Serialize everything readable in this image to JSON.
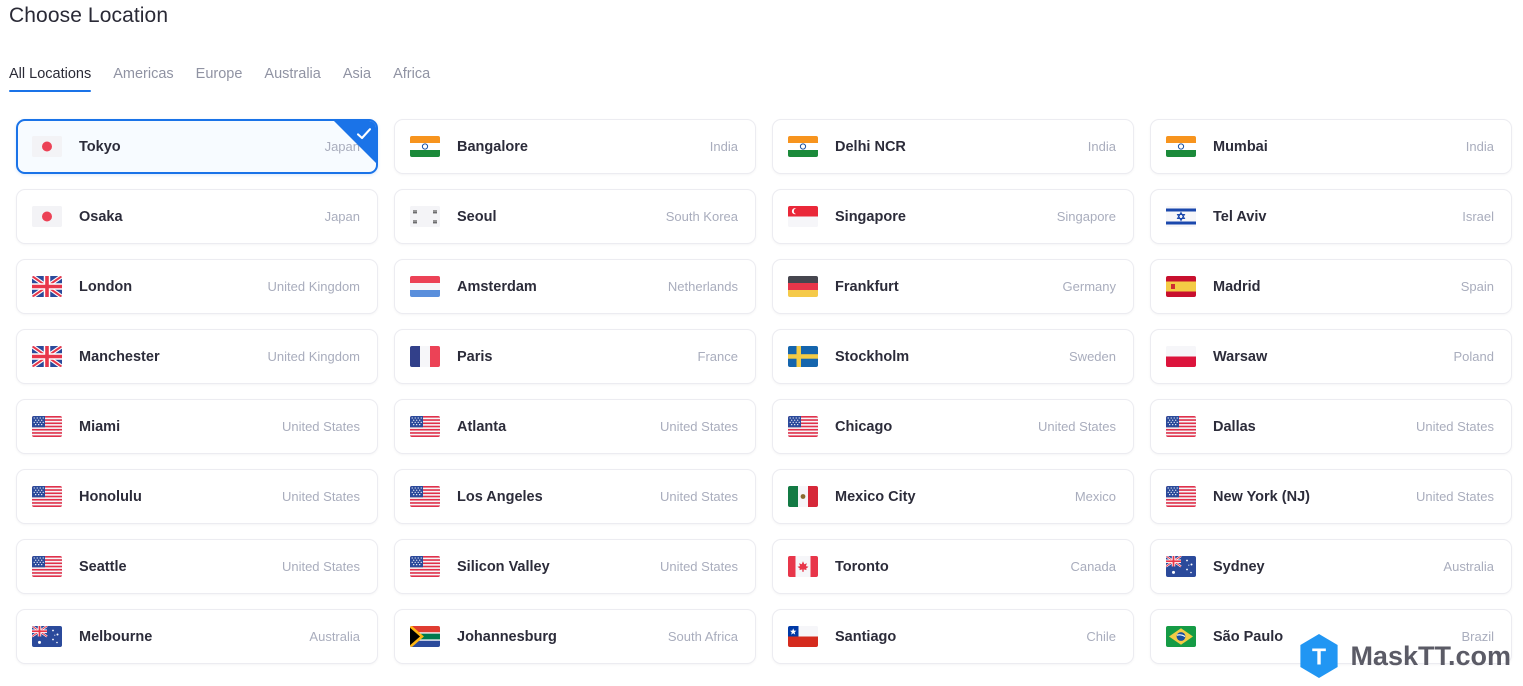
{
  "header": {
    "title": "Choose Location"
  },
  "tabs": [
    {
      "label": "All Locations",
      "active": true
    },
    {
      "label": "Americas",
      "active": false
    },
    {
      "label": "Europe",
      "active": false
    },
    {
      "label": "Australia",
      "active": false
    },
    {
      "label": "Asia",
      "active": false
    },
    {
      "label": "Africa",
      "active": false
    }
  ],
  "colors": {
    "accent": "#1a73e8",
    "card_border": "#ececf1",
    "city_text": "#2c2c3a",
    "country_text": "#a9adbd",
    "selected_bg": "#f7fbff",
    "watermark_text": "#5b5b66"
  },
  "selection": {
    "selected_city": "Tokyo",
    "check_icon": "check-icon"
  },
  "locations": [
    {
      "city": "Tokyo",
      "country": "Japan",
      "flag": "jp",
      "selected": true
    },
    {
      "city": "Bangalore",
      "country": "India",
      "flag": "in",
      "selected": false
    },
    {
      "city": "Delhi NCR",
      "country": "India",
      "flag": "in",
      "selected": false
    },
    {
      "city": "Mumbai",
      "country": "India",
      "flag": "in",
      "selected": false
    },
    {
      "city": "Osaka",
      "country": "Japan",
      "flag": "jp",
      "selected": false
    },
    {
      "city": "Seoul",
      "country": "South Korea",
      "flag": "kr",
      "selected": false
    },
    {
      "city": "Singapore",
      "country": "Singapore",
      "flag": "sg",
      "selected": false
    },
    {
      "city": "Tel Aviv",
      "country": "Israel",
      "flag": "il",
      "selected": false
    },
    {
      "city": "London",
      "country": "United Kingdom",
      "flag": "gb",
      "selected": false
    },
    {
      "city": "Amsterdam",
      "country": "Netherlands",
      "flag": "nl",
      "selected": false
    },
    {
      "city": "Frankfurt",
      "country": "Germany",
      "flag": "de",
      "selected": false
    },
    {
      "city": "Madrid",
      "country": "Spain",
      "flag": "es",
      "selected": false
    },
    {
      "city": "Manchester",
      "country": "United Kingdom",
      "flag": "gb",
      "selected": false
    },
    {
      "city": "Paris",
      "country": "France",
      "flag": "fr",
      "selected": false
    },
    {
      "city": "Stockholm",
      "country": "Sweden",
      "flag": "se",
      "selected": false
    },
    {
      "city": "Warsaw",
      "country": "Poland",
      "flag": "pl",
      "selected": false
    },
    {
      "city": "Miami",
      "country": "United States",
      "flag": "us",
      "selected": false
    },
    {
      "city": "Atlanta",
      "country": "United States",
      "flag": "us",
      "selected": false
    },
    {
      "city": "Chicago",
      "country": "United States",
      "flag": "us",
      "selected": false
    },
    {
      "city": "Dallas",
      "country": "United States",
      "flag": "us",
      "selected": false
    },
    {
      "city": "Honolulu",
      "country": "United States",
      "flag": "us",
      "selected": false
    },
    {
      "city": "Los Angeles",
      "country": "United States",
      "flag": "us",
      "selected": false
    },
    {
      "city": "Mexico City",
      "country": "Mexico",
      "flag": "mx",
      "selected": false
    },
    {
      "city": "New York (NJ)",
      "country": "United States",
      "flag": "us",
      "selected": false
    },
    {
      "city": "Seattle",
      "country": "United States",
      "flag": "us",
      "selected": false
    },
    {
      "city": "Silicon Valley",
      "country": "United States",
      "flag": "us",
      "selected": false
    },
    {
      "city": "Toronto",
      "country": "Canada",
      "flag": "ca",
      "selected": false
    },
    {
      "city": "Sydney",
      "country": "Australia",
      "flag": "au",
      "selected": false
    },
    {
      "city": "Melbourne",
      "country": "Australia",
      "flag": "au",
      "selected": false
    },
    {
      "city": "Johannesburg",
      "country": "South Africa",
      "flag": "za",
      "selected": false
    },
    {
      "city": "Santiago",
      "country": "Chile",
      "flag": "cl",
      "selected": false
    },
    {
      "city": "São Paulo",
      "country": "Brazil",
      "flag": "br",
      "selected": false
    }
  ],
  "watermark": {
    "text": "MaskTT.com",
    "logo_letter": "T",
    "logo_icon": "hexagon-logo-icon"
  }
}
